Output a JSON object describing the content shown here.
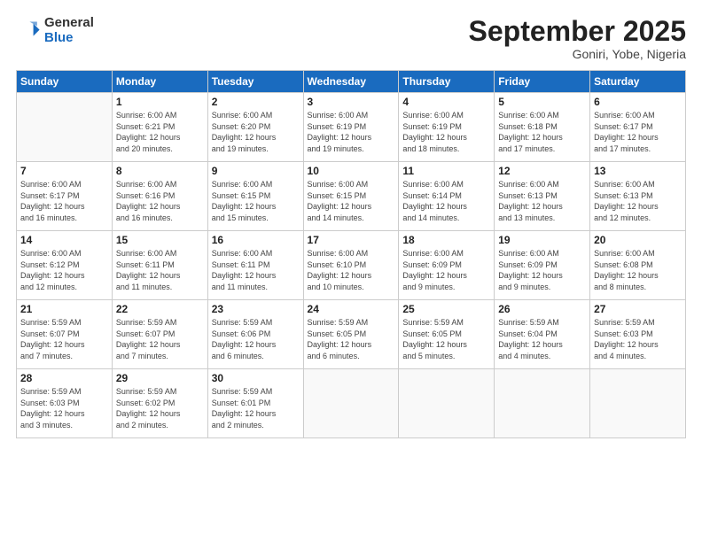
{
  "header": {
    "logo_general": "General",
    "logo_blue": "Blue",
    "title": "September 2025",
    "location": "Goniri, Yobe, Nigeria"
  },
  "days_of_week": [
    "Sunday",
    "Monday",
    "Tuesday",
    "Wednesday",
    "Thursday",
    "Friday",
    "Saturday"
  ],
  "weeks": [
    [
      {
        "day": "",
        "info": ""
      },
      {
        "day": "1",
        "info": "Sunrise: 6:00 AM\nSunset: 6:21 PM\nDaylight: 12 hours\nand 20 minutes."
      },
      {
        "day": "2",
        "info": "Sunrise: 6:00 AM\nSunset: 6:20 PM\nDaylight: 12 hours\nand 19 minutes."
      },
      {
        "day": "3",
        "info": "Sunrise: 6:00 AM\nSunset: 6:19 PM\nDaylight: 12 hours\nand 19 minutes."
      },
      {
        "day": "4",
        "info": "Sunrise: 6:00 AM\nSunset: 6:19 PM\nDaylight: 12 hours\nand 18 minutes."
      },
      {
        "day": "5",
        "info": "Sunrise: 6:00 AM\nSunset: 6:18 PM\nDaylight: 12 hours\nand 17 minutes."
      },
      {
        "day": "6",
        "info": "Sunrise: 6:00 AM\nSunset: 6:17 PM\nDaylight: 12 hours\nand 17 minutes."
      }
    ],
    [
      {
        "day": "7",
        "info": "Sunrise: 6:00 AM\nSunset: 6:17 PM\nDaylight: 12 hours\nand 16 minutes."
      },
      {
        "day": "8",
        "info": "Sunrise: 6:00 AM\nSunset: 6:16 PM\nDaylight: 12 hours\nand 16 minutes."
      },
      {
        "day": "9",
        "info": "Sunrise: 6:00 AM\nSunset: 6:15 PM\nDaylight: 12 hours\nand 15 minutes."
      },
      {
        "day": "10",
        "info": "Sunrise: 6:00 AM\nSunset: 6:15 PM\nDaylight: 12 hours\nand 14 minutes."
      },
      {
        "day": "11",
        "info": "Sunrise: 6:00 AM\nSunset: 6:14 PM\nDaylight: 12 hours\nand 14 minutes."
      },
      {
        "day": "12",
        "info": "Sunrise: 6:00 AM\nSunset: 6:13 PM\nDaylight: 12 hours\nand 13 minutes."
      },
      {
        "day": "13",
        "info": "Sunrise: 6:00 AM\nSunset: 6:13 PM\nDaylight: 12 hours\nand 12 minutes."
      }
    ],
    [
      {
        "day": "14",
        "info": "Sunrise: 6:00 AM\nSunset: 6:12 PM\nDaylight: 12 hours\nand 12 minutes."
      },
      {
        "day": "15",
        "info": "Sunrise: 6:00 AM\nSunset: 6:11 PM\nDaylight: 12 hours\nand 11 minutes."
      },
      {
        "day": "16",
        "info": "Sunrise: 6:00 AM\nSunset: 6:11 PM\nDaylight: 12 hours\nand 11 minutes."
      },
      {
        "day": "17",
        "info": "Sunrise: 6:00 AM\nSunset: 6:10 PM\nDaylight: 12 hours\nand 10 minutes."
      },
      {
        "day": "18",
        "info": "Sunrise: 6:00 AM\nSunset: 6:09 PM\nDaylight: 12 hours\nand 9 minutes."
      },
      {
        "day": "19",
        "info": "Sunrise: 6:00 AM\nSunset: 6:09 PM\nDaylight: 12 hours\nand 9 minutes."
      },
      {
        "day": "20",
        "info": "Sunrise: 6:00 AM\nSunset: 6:08 PM\nDaylight: 12 hours\nand 8 minutes."
      }
    ],
    [
      {
        "day": "21",
        "info": "Sunrise: 5:59 AM\nSunset: 6:07 PM\nDaylight: 12 hours\nand 7 minutes."
      },
      {
        "day": "22",
        "info": "Sunrise: 5:59 AM\nSunset: 6:07 PM\nDaylight: 12 hours\nand 7 minutes."
      },
      {
        "day": "23",
        "info": "Sunrise: 5:59 AM\nSunset: 6:06 PM\nDaylight: 12 hours\nand 6 minutes."
      },
      {
        "day": "24",
        "info": "Sunrise: 5:59 AM\nSunset: 6:05 PM\nDaylight: 12 hours\nand 6 minutes."
      },
      {
        "day": "25",
        "info": "Sunrise: 5:59 AM\nSunset: 6:05 PM\nDaylight: 12 hours\nand 5 minutes."
      },
      {
        "day": "26",
        "info": "Sunrise: 5:59 AM\nSunset: 6:04 PM\nDaylight: 12 hours\nand 4 minutes."
      },
      {
        "day": "27",
        "info": "Sunrise: 5:59 AM\nSunset: 6:03 PM\nDaylight: 12 hours\nand 4 minutes."
      }
    ],
    [
      {
        "day": "28",
        "info": "Sunrise: 5:59 AM\nSunset: 6:03 PM\nDaylight: 12 hours\nand 3 minutes."
      },
      {
        "day": "29",
        "info": "Sunrise: 5:59 AM\nSunset: 6:02 PM\nDaylight: 12 hours\nand 2 minutes."
      },
      {
        "day": "30",
        "info": "Sunrise: 5:59 AM\nSunset: 6:01 PM\nDaylight: 12 hours\nand 2 minutes."
      },
      {
        "day": "",
        "info": ""
      },
      {
        "day": "",
        "info": ""
      },
      {
        "day": "",
        "info": ""
      },
      {
        "day": "",
        "info": ""
      }
    ]
  ]
}
